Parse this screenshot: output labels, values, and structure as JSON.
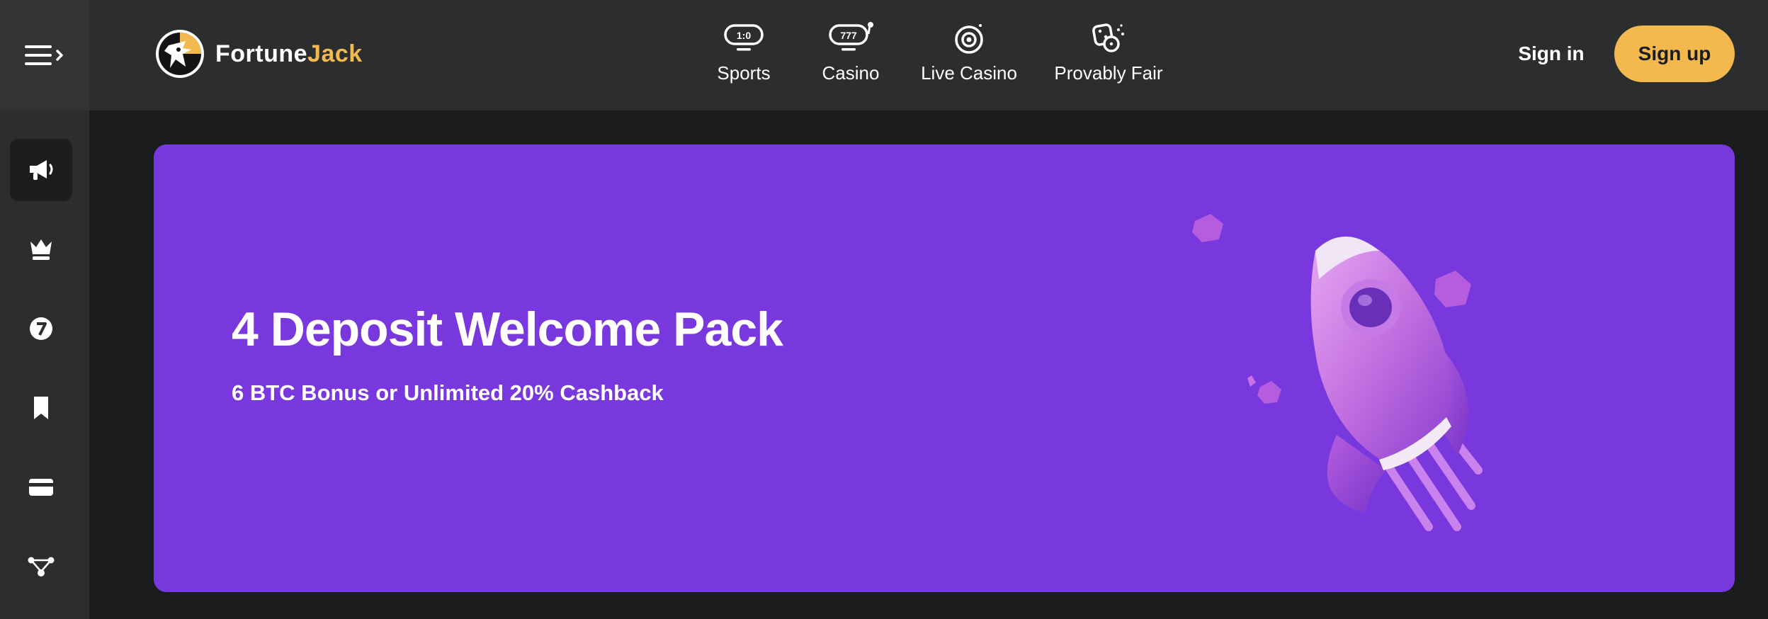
{
  "header": {
    "logo": {
      "part1": "Fortune",
      "part2": "Jack"
    },
    "nav": [
      {
        "label": "Sports",
        "icon": "scoreboard-icon"
      },
      {
        "label": "Casino",
        "icon": "slot-777-icon"
      },
      {
        "label": "Live Casino",
        "icon": "roulette-target-icon"
      },
      {
        "label": "Provably Fair",
        "icon": "dice-icon"
      }
    ],
    "signin_label": "Sign in",
    "signup_label": "Sign up"
  },
  "sidebar": {
    "items": [
      {
        "icon": "megaphone-icon",
        "active": true
      },
      {
        "icon": "crown-icon"
      },
      {
        "icon": "lucky-seven-icon"
      },
      {
        "icon": "bookmark-icon"
      },
      {
        "icon": "card-icon"
      },
      {
        "icon": "network-icon"
      }
    ]
  },
  "banner": {
    "title": "4 Deposit Welcome Pack",
    "subtitle": "6 BTC Bonus or Unlimited 20% Cashback"
  },
  "colors": {
    "topbar": "#2c2d2f",
    "page_bg": "#1b1c1e",
    "accent_yellow": "#f3b94f",
    "banner_purple": "#7838de"
  }
}
